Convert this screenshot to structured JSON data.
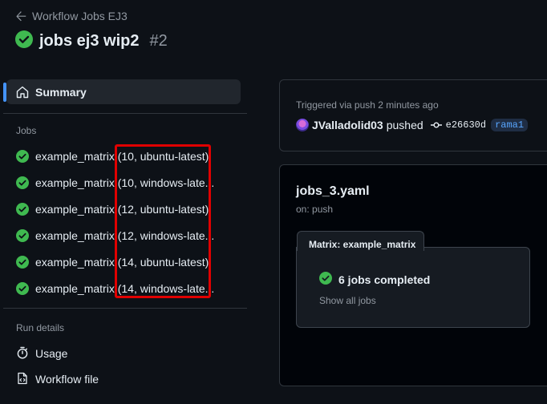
{
  "header": {
    "back_label": "Workflow Jobs EJ3",
    "title": "jobs ej3 wip2",
    "run_number": "#2"
  },
  "sidebar": {
    "summary_label": "Summary",
    "jobs_heading": "Jobs",
    "jobs": [
      {
        "label": "example_matrix (10, ubuntu-latest)",
        "status": "success"
      },
      {
        "label": "example_matrix (10, windows-late...",
        "status": "success"
      },
      {
        "label": "example_matrix (12, ubuntu-latest)",
        "status": "success"
      },
      {
        "label": "example_matrix (12, windows-late...",
        "status": "success"
      },
      {
        "label": "example_matrix (14, ubuntu-latest)",
        "status": "success"
      },
      {
        "label": "example_matrix (14, windows-late...",
        "status": "success"
      }
    ],
    "run_details_heading": "Run details",
    "details": [
      {
        "label": "Usage",
        "icon": "stopwatch-icon"
      },
      {
        "label": "Workflow file",
        "icon": "file-icon"
      }
    ]
  },
  "trigger": {
    "text": "Triggered via push 2 minutes ago",
    "user": "JValladolid03",
    "action": "pushed",
    "commit": "e26630d",
    "branch": "rama1"
  },
  "workflow": {
    "name": "jobs_3.yaml",
    "on": "on: push",
    "matrix_title": "Matrix: example_matrix",
    "status": "6 jobs completed",
    "show_all": "Show all jobs"
  },
  "colors": {
    "success": "#3fb950",
    "accent": "#4493f8",
    "highlight": "#e00000"
  }
}
